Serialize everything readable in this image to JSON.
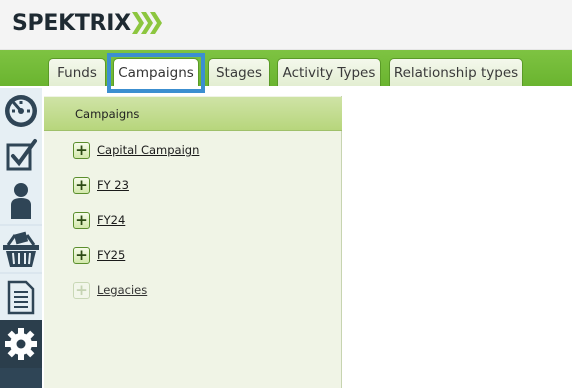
{
  "brand": {
    "name": "SPEKTRIX",
    "accent": "#7ec342",
    "chevron_color": "#8cc63f"
  },
  "tabs": [
    {
      "label": "Funds",
      "active": false
    },
    {
      "label": "Campaigns",
      "active": true
    },
    {
      "label": "Stages",
      "active": false
    },
    {
      "label": "Activity Types",
      "active": false
    },
    {
      "label": "Relationship types",
      "active": false
    }
  ],
  "sidebar": {
    "items": [
      {
        "icon": "dashboard-gauge-icon"
      },
      {
        "icon": "checklist-icon"
      },
      {
        "icon": "person-icon"
      },
      {
        "icon": "basket-icon"
      },
      {
        "icon": "document-icon"
      },
      {
        "icon": "gear-icon",
        "active": true
      }
    ]
  },
  "panel": {
    "title": "Campaigns",
    "items": [
      {
        "label": "Capital Campaign",
        "enabled": true
      },
      {
        "label": "FY 23",
        "enabled": true
      },
      {
        "label": "FY24",
        "enabled": true
      },
      {
        "label": "FY25",
        "enabled": true
      },
      {
        "label": "Legacies",
        "enabled": false
      }
    ]
  }
}
